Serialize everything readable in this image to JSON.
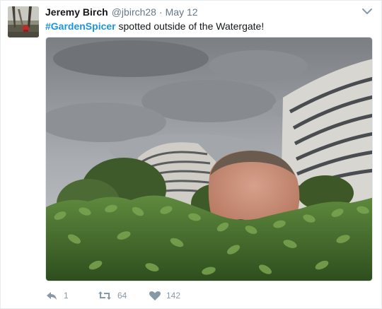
{
  "tweet": {
    "author_name": "Jeremy Birch",
    "author_handle": "@jbirch28",
    "separator": "·",
    "timestamp": "May 12",
    "hashtag": "#GardenSpicer",
    "text": "spotted outside of the Watergate!",
    "media_description": "Cut-out face peeking over a hedge in front of the Watergate building under a cloudy sky"
  },
  "actions": {
    "reply_count": "1",
    "retweet_count": "64",
    "like_count": "142"
  },
  "colors": {
    "link": "#1b95e0",
    "muted": "#657786",
    "action": "#8899a6",
    "border": "#e6ecf0"
  },
  "icons": [
    "avatar-photo",
    "chevron-down-icon",
    "reply-icon",
    "retweet-icon",
    "heart-icon"
  ]
}
